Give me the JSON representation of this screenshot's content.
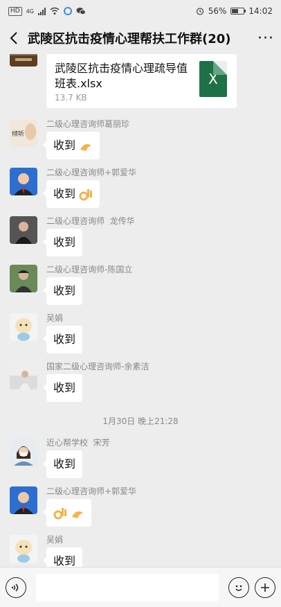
{
  "status_bar": {
    "left_badges": [
      "HD",
      "4G"
    ],
    "battery": "56%",
    "battery_level": 0.56,
    "time": "14:02"
  },
  "header": {
    "title": "武陵区抗击疫情心理帮扶工作群(20)",
    "back_icon": "chevron-left-icon",
    "more_icon": "more-dots-icon",
    "more_label": "···"
  },
  "messages": {
    "file": {
      "file_name": "武陵区抗击疫情心理疏导值班表.xlsx",
      "file_size": "13.7 KB",
      "file_icon_letter": "X"
    },
    "m1": {
      "sender": "二级心理咨询师葛丽珍",
      "text": "收到",
      "avatar_text": "倾听"
    },
    "m2": {
      "sender": "二级心理咨询师+郭爱华",
      "text": "收到"
    },
    "m3": {
      "sender": "二级心理咨询师  龙传华",
      "text": "收到"
    },
    "m4": {
      "sender": "二级心理咨询师-陈国立",
      "text": "收到"
    },
    "m5": {
      "sender": "吴娟",
      "text": "收到"
    },
    "m6": {
      "sender": "国家二级心理咨询师-余素洁",
      "text": "收到"
    },
    "timestamp": "1月30日 晚上21:28",
    "m7": {
      "sender": "近心帮学校  宋芳",
      "text": "收到"
    },
    "m8": {
      "sender": "二级心理咨询师+郭爱华",
      "text": ""
    },
    "m9": {
      "sender": "吴娟",
      "text": "收到"
    }
  },
  "colors": {
    "background": "#ededed",
    "bubble": "#ffffff",
    "excel_green": "#1e7145"
  }
}
